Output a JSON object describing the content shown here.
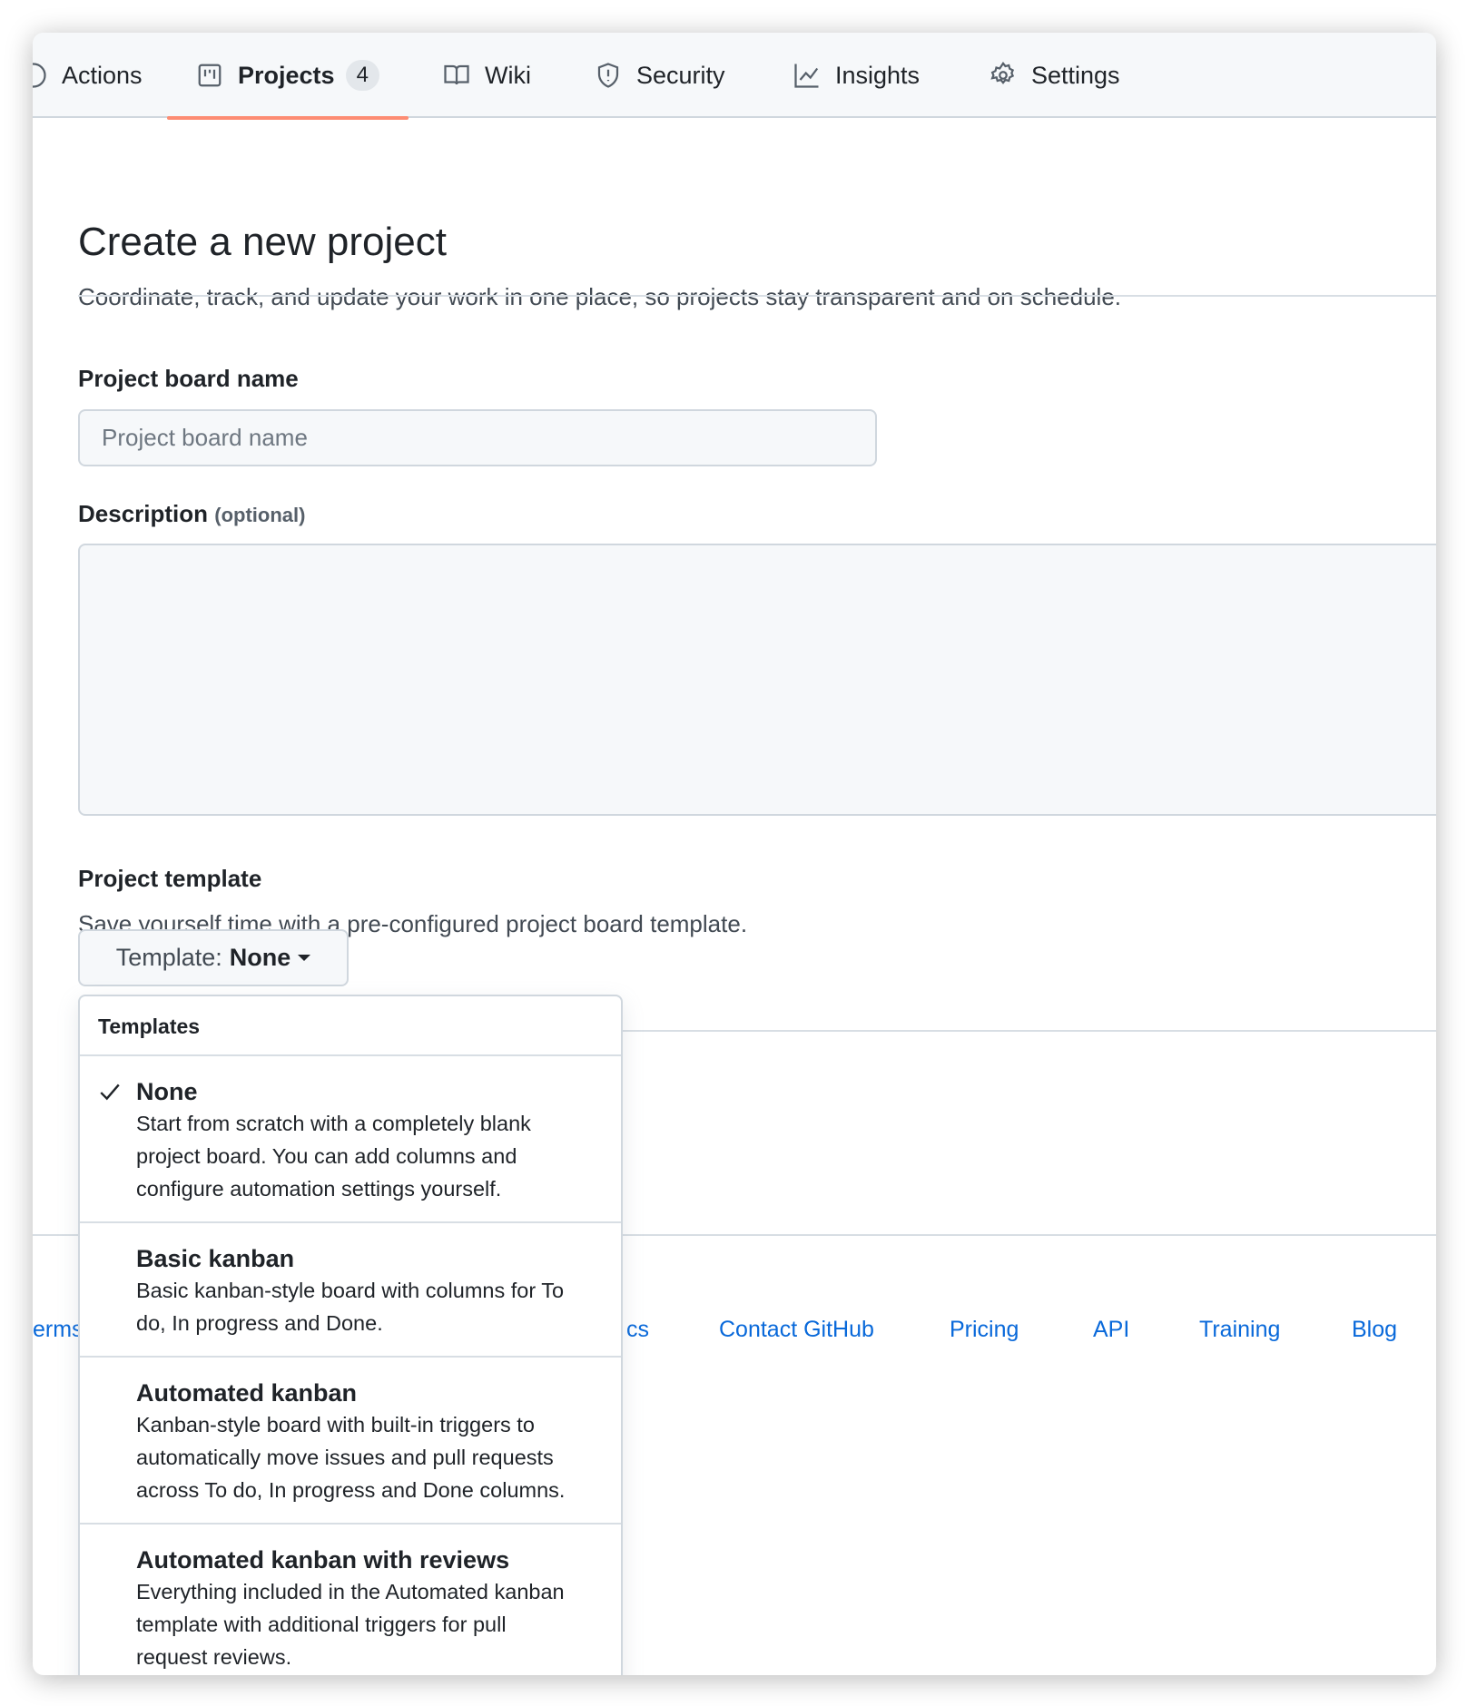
{
  "tabs": [
    {
      "label": "Actions",
      "icon": "play-icon"
    },
    {
      "label": "Projects",
      "icon": "project-icon",
      "count": "4",
      "selected": true
    },
    {
      "label": "Wiki",
      "icon": "book-icon"
    },
    {
      "label": "Security",
      "icon": "shield-icon"
    },
    {
      "label": "Insights",
      "icon": "graph-icon"
    },
    {
      "label": "Settings",
      "icon": "gear-icon"
    }
  ],
  "page": {
    "title": "Create a new project",
    "subtitle": "Coordinate, track, and update your work in one place, so projects stay transparent and on schedule."
  },
  "form": {
    "name_label": "Project board name",
    "name_placeholder": "Project board name",
    "name_value": "",
    "desc_label": "Description",
    "desc_optional": "(optional)",
    "template_label": "Project template",
    "template_help": "Save yourself time with a pre-configured project board template.",
    "template_button_prefix": "Template:",
    "template_button_value": "None"
  },
  "dropdown": {
    "header": "Templates",
    "items": [
      {
        "title": "None",
        "lines": [
          "Start from scratch with a completely blank",
          "project board. You can add columns and",
          "configure automation settings yourself."
        ],
        "selected": true
      },
      {
        "title": "Basic kanban",
        "lines": [
          "Basic kanban-style board with columns for To",
          "do, In progress and Done."
        ]
      },
      {
        "title": "Automated kanban",
        "lines": [
          "Kanban-style board with built-in triggers to",
          "automatically move issues and pull requests",
          "across To do, In progress and Done columns."
        ]
      },
      {
        "title": "Automated kanban with reviews",
        "lines": [
          "Everything included in the Automated kanban",
          "template with additional triggers for pull",
          "request reviews."
        ]
      }
    ]
  },
  "footer": {
    "links": [
      "erms",
      "cs",
      "Contact GitHub",
      "Pricing",
      "API",
      "Training",
      "Blog"
    ]
  },
  "colors": {
    "accent_underline": "#fd8c73",
    "link": "#0969da"
  }
}
